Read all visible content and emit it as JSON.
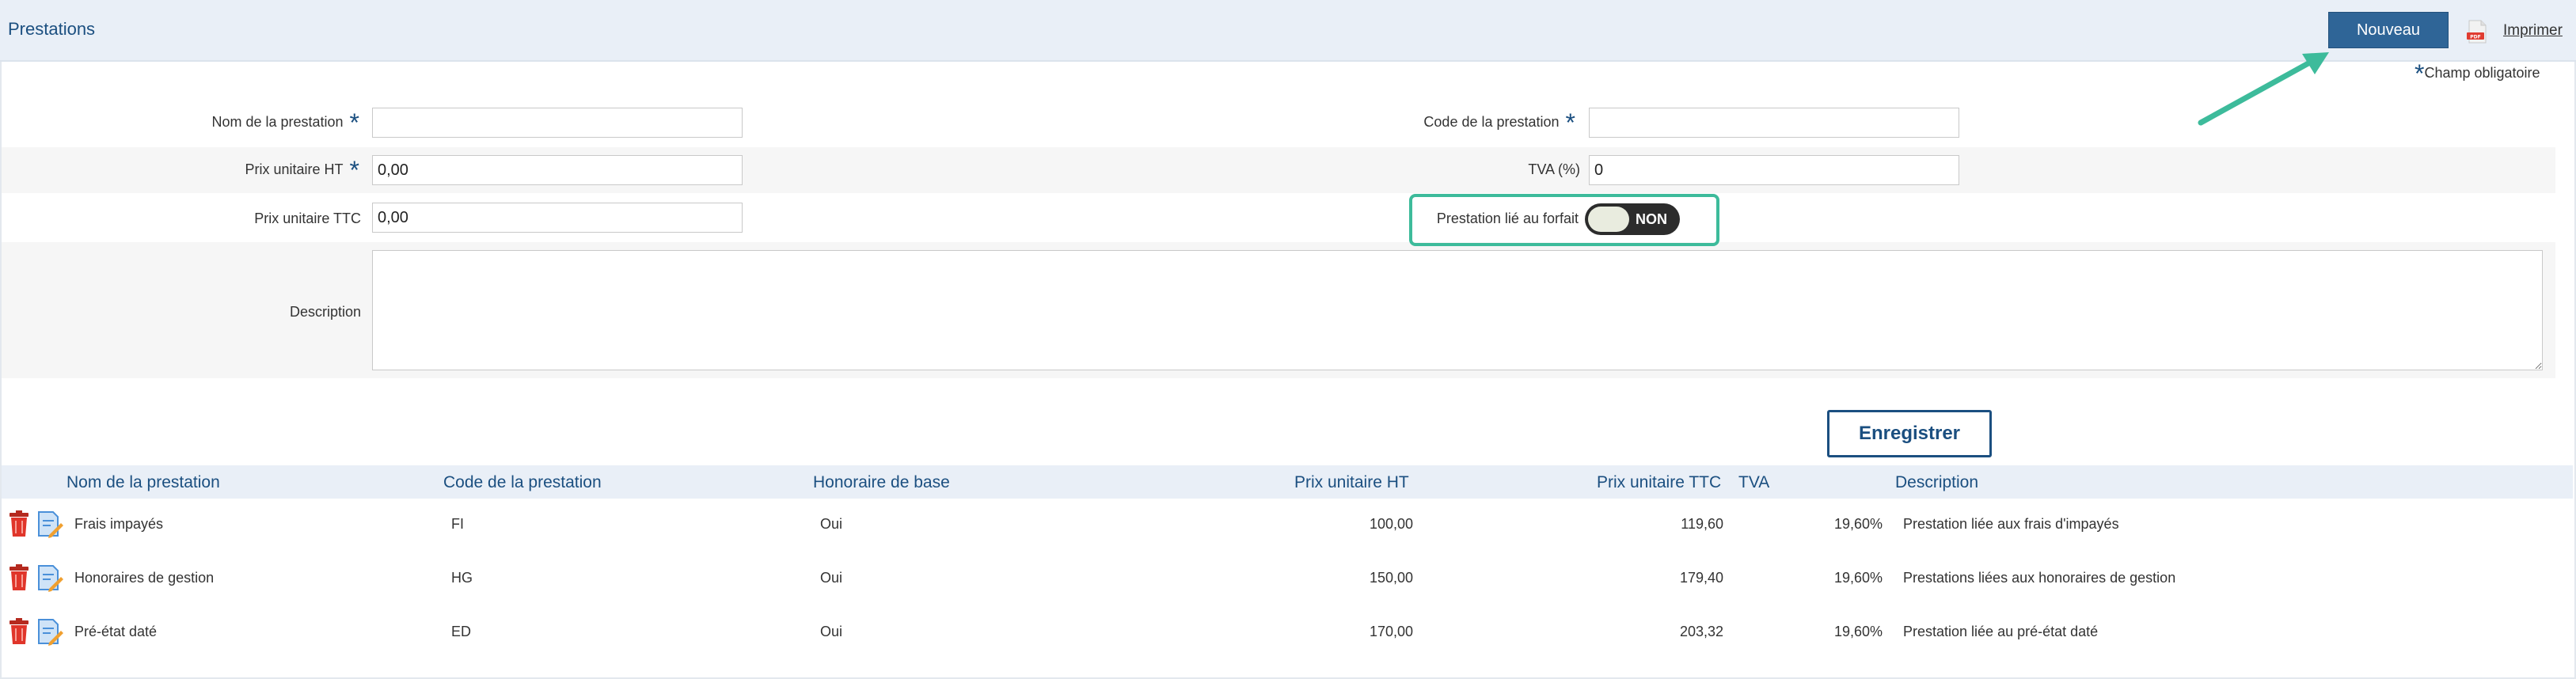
{
  "header": {
    "title": "Prestations",
    "new_button": "Nouveau",
    "print_label": "Imprimer",
    "print_icon": "pdf-icon"
  },
  "form": {
    "required_note": "Champ obligatoire",
    "nom_label": "Nom de la prestation",
    "nom_value": "",
    "code_label": "Code de la prestation",
    "code_value": "",
    "prix_ht_label": "Prix unitaire HT",
    "prix_ht_value": "0,00",
    "tva_label": "TVA (%)",
    "tva_value": "0",
    "prix_ttc_label": "Prix unitaire TTC",
    "prix_ttc_value": "0,00",
    "forfait_label": "Prestation lié au forfait",
    "forfait_toggle": "NON",
    "description_label": "Description",
    "description_value": "",
    "save_button": "Enregistrer"
  },
  "table": {
    "headers": [
      "Nom de la prestation",
      "Code de la prestation",
      "Honoraire de base",
      "Prix unitaire HT",
      "Prix unitaire TTC",
      "TVA",
      "Description"
    ],
    "rows": [
      {
        "nom": "Frais impayés",
        "code": "FI",
        "honoraire": "Oui",
        "prix_ht": "100,00",
        "prix_ttc": "119,60",
        "tva": "19,60%",
        "description": "Prestation liée aux frais d'impayés"
      },
      {
        "nom": "Honoraires de gestion",
        "code": "HG",
        "honoraire": "Oui",
        "prix_ht": "150,00",
        "prix_ttc": "179,40",
        "tva": "19,60%",
        "description": "Prestations liées aux honoraires de gestion"
      },
      {
        "nom": "Pré-état daté",
        "code": "ED",
        "honoraire": "Oui",
        "prix_ht": "170,00",
        "prix_ttc": "203,32",
        "tva": "19,60%",
        "description": "Prestation liée au pré-état daté"
      }
    ]
  },
  "colors": {
    "accent": "#2f6597",
    "title_blue": "#1b4f80",
    "highlight_green": "#3dbb9b",
    "header_bg": "#e9eff7"
  }
}
